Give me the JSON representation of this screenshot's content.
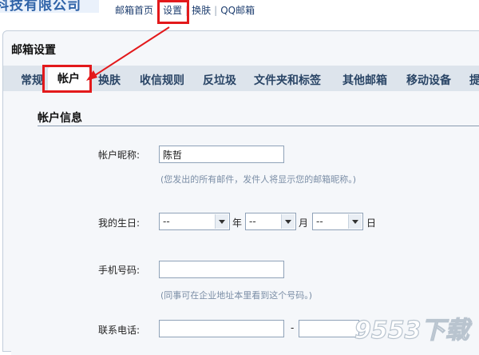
{
  "header": {
    "company_text": "科技有限公司",
    "links": [
      "邮箱首页",
      "设置",
      "换肤",
      "QQ邮箱"
    ]
  },
  "panel": {
    "title": "邮箱设置",
    "tabs": [
      "常规",
      "帐户",
      "换肤",
      "收信规则",
      "反垃圾",
      "文件夹和标签",
      "其他邮箱",
      "移动设备",
      "提"
    ],
    "active_tab": "帐户"
  },
  "account": {
    "section_title": "帐户信息",
    "nickname_label": "帐户昵称:",
    "nickname_value": "陈哲",
    "nickname_hint": "(您发出的所有邮件，发件人将显示您的邮箱昵称。)",
    "birthday_label": "我的生日:",
    "birthday": {
      "year": "--",
      "month": "--",
      "day": "--",
      "year_unit": "年",
      "month_unit": "月",
      "day_unit": "日"
    },
    "mobile_label": "手机号码:",
    "mobile_hint": "(同事可在企业地址本里看到这个号码。)",
    "phone_label": "联系电话:",
    "phone_separator": "-"
  },
  "watermark": {
    "text": "9553下载"
  },
  "colors": {
    "highlight": "#e3191b",
    "tab_bar": "#dde4ec",
    "link": "#1f3f70",
    "hint": "#7b8ea6"
  }
}
